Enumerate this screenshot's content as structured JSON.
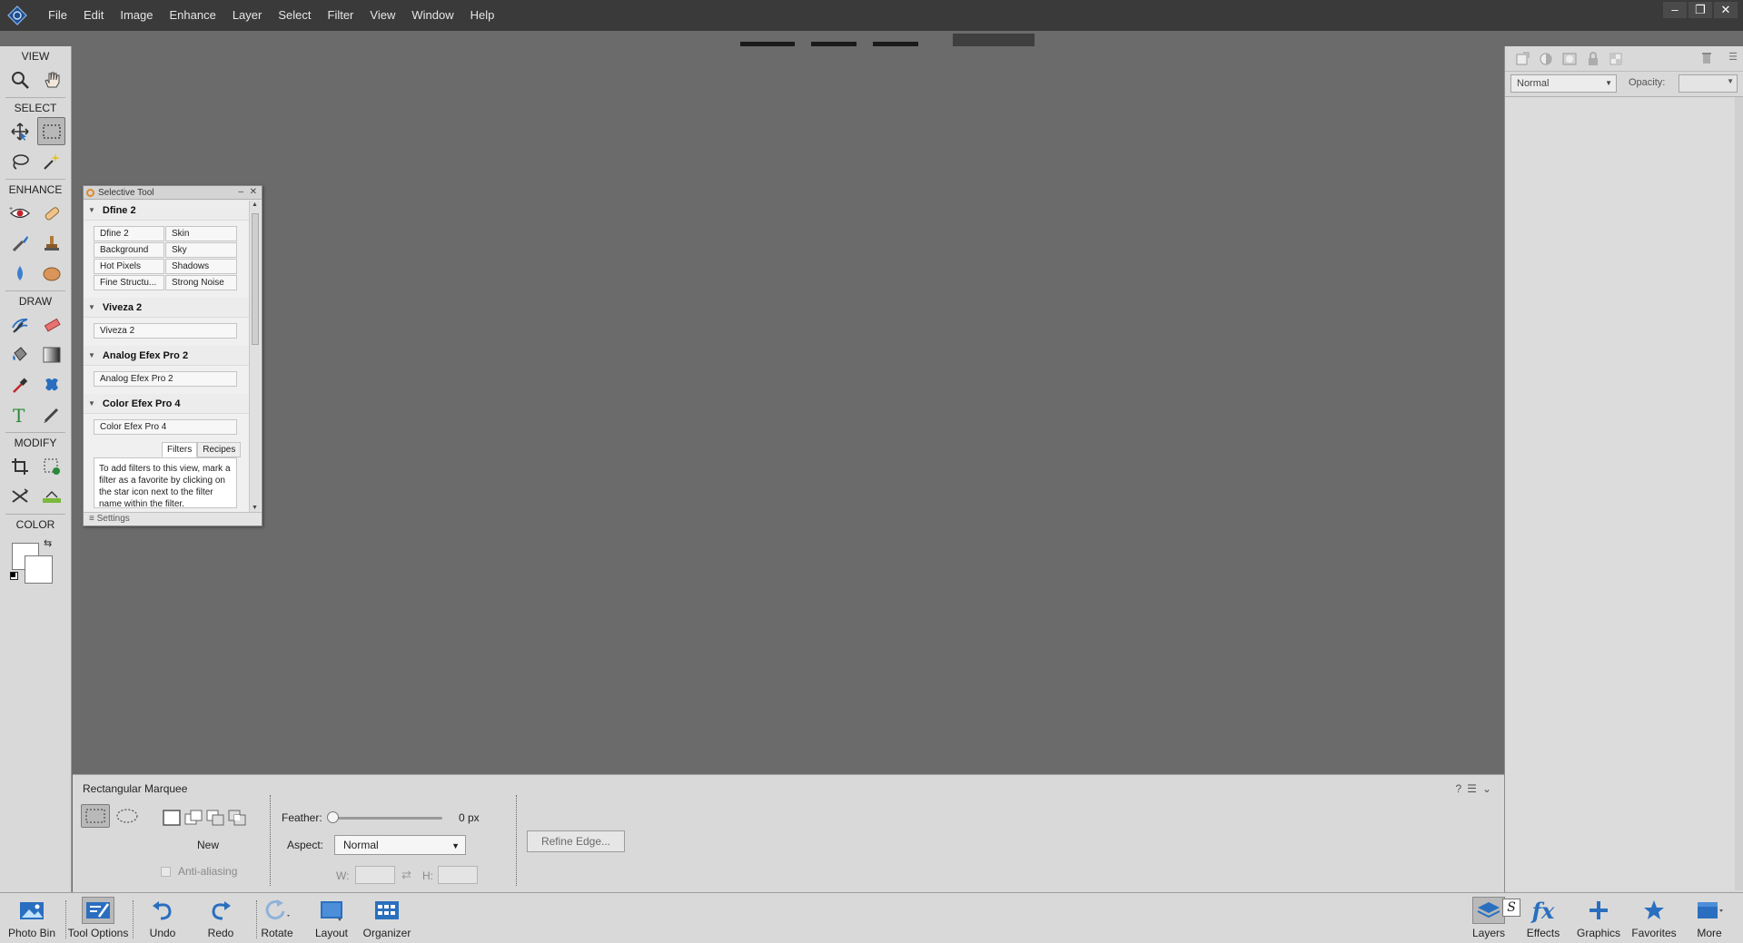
{
  "menubar": {
    "items": [
      "File",
      "Edit",
      "Image",
      "Enhance",
      "Layer",
      "Select",
      "Filter",
      "View",
      "Window",
      "Help"
    ],
    "window_controls": [
      "–",
      "❐",
      "✕"
    ]
  },
  "toolbox": {
    "sections": {
      "view": "VIEW",
      "select": "SELECT",
      "enhance": "ENHANCE",
      "draw": "DRAW",
      "modify": "MODIFY",
      "color": "COLOR"
    }
  },
  "selective_tool": {
    "title": "Selective Tool",
    "groups": [
      {
        "name": "Dfine 2",
        "items": [
          "Dfine 2",
          "Skin",
          "Background",
          "Sky",
          "Hot Pixels",
          "Shadows",
          "Fine Structu...",
          "Strong Noise"
        ]
      },
      {
        "name": "Viveza 2",
        "items": [
          "Viveza 2"
        ]
      },
      {
        "name": "Analog Efex Pro 2",
        "items": [
          "Analog Efex Pro 2"
        ]
      },
      {
        "name": "Color Efex Pro 4",
        "items": [
          "Color Efex Pro 4"
        ]
      }
    ],
    "tabs": [
      "Filters",
      "Recipes"
    ],
    "info_text": "To add filters to this view, mark a filter as a favorite by clicking on the star icon next to the filter name within the filter.",
    "footer": "Settings"
  },
  "tool_options": {
    "tool_name": "Rectangular Marquee",
    "new_label": "New",
    "anti_aliasing": "Anti-aliasing",
    "feather_label": "Feather:",
    "feather_value": "0 px",
    "feather_fraction": 0,
    "aspect_label": "Aspect:",
    "aspect_value": "Normal",
    "w_label": "W:",
    "h_label": "H:",
    "refine_edge": "Refine Edge..."
  },
  "right_panel": {
    "blend_mode": "Normal",
    "opacity_label": "Opacity:"
  },
  "bottombar": {
    "left": [
      {
        "label": "Photo Bin",
        "icon": "photo-bin-icon"
      },
      {
        "label": "Tool Options",
        "icon": "tool-options-icon"
      },
      {
        "label": "Undo",
        "icon": "undo-icon"
      },
      {
        "label": "Redo",
        "icon": "redo-icon"
      },
      {
        "label": "Rotate",
        "icon": "rotate-icon"
      },
      {
        "label": "Layout",
        "icon": "layout-icon"
      },
      {
        "label": "Organizer",
        "icon": "organizer-icon"
      }
    ],
    "right": [
      {
        "label": "Layers",
        "icon": "layers-icon"
      },
      {
        "label": "Effects",
        "icon": "effects-icon"
      },
      {
        "label": "Graphics",
        "icon": "graphics-icon"
      },
      {
        "label": "Favorites",
        "icon": "favorites-icon"
      },
      {
        "label": "More",
        "icon": "more-icon"
      }
    ]
  },
  "colors": {
    "menubar_bg": "#3a3a3a",
    "panel_bg": "#d9d9d9",
    "canvas_bg": "#6b6b6b",
    "accent_blue": "#2a6fbf"
  }
}
